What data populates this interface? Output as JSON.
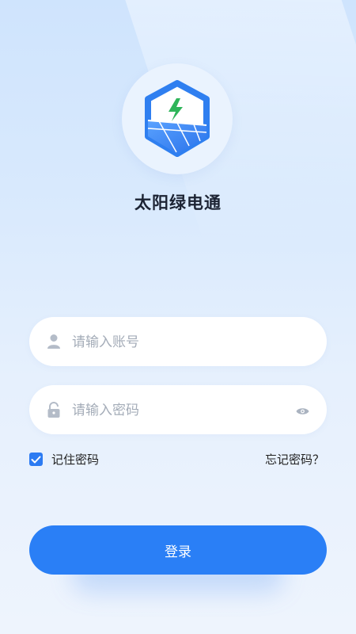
{
  "app": {
    "title": "太阳绿电通"
  },
  "form": {
    "account_placeholder": "请输入账号",
    "password_placeholder": "请输入密码",
    "remember_label": "记住密码",
    "remember_checked": true,
    "forgot_label": "忘记密码？",
    "login_label": "登录"
  },
  "icons": {
    "logo": "solar-bolt-shield-icon",
    "account": "user-icon",
    "password": "lock-icon",
    "toggle_password": "eye-icon",
    "checkbox": "check-icon"
  },
  "colors": {
    "primary": "#2a7ff6",
    "bolt": "#2fb55a",
    "text_dark": "#1c2333",
    "placeholder": "#a4acb8"
  }
}
